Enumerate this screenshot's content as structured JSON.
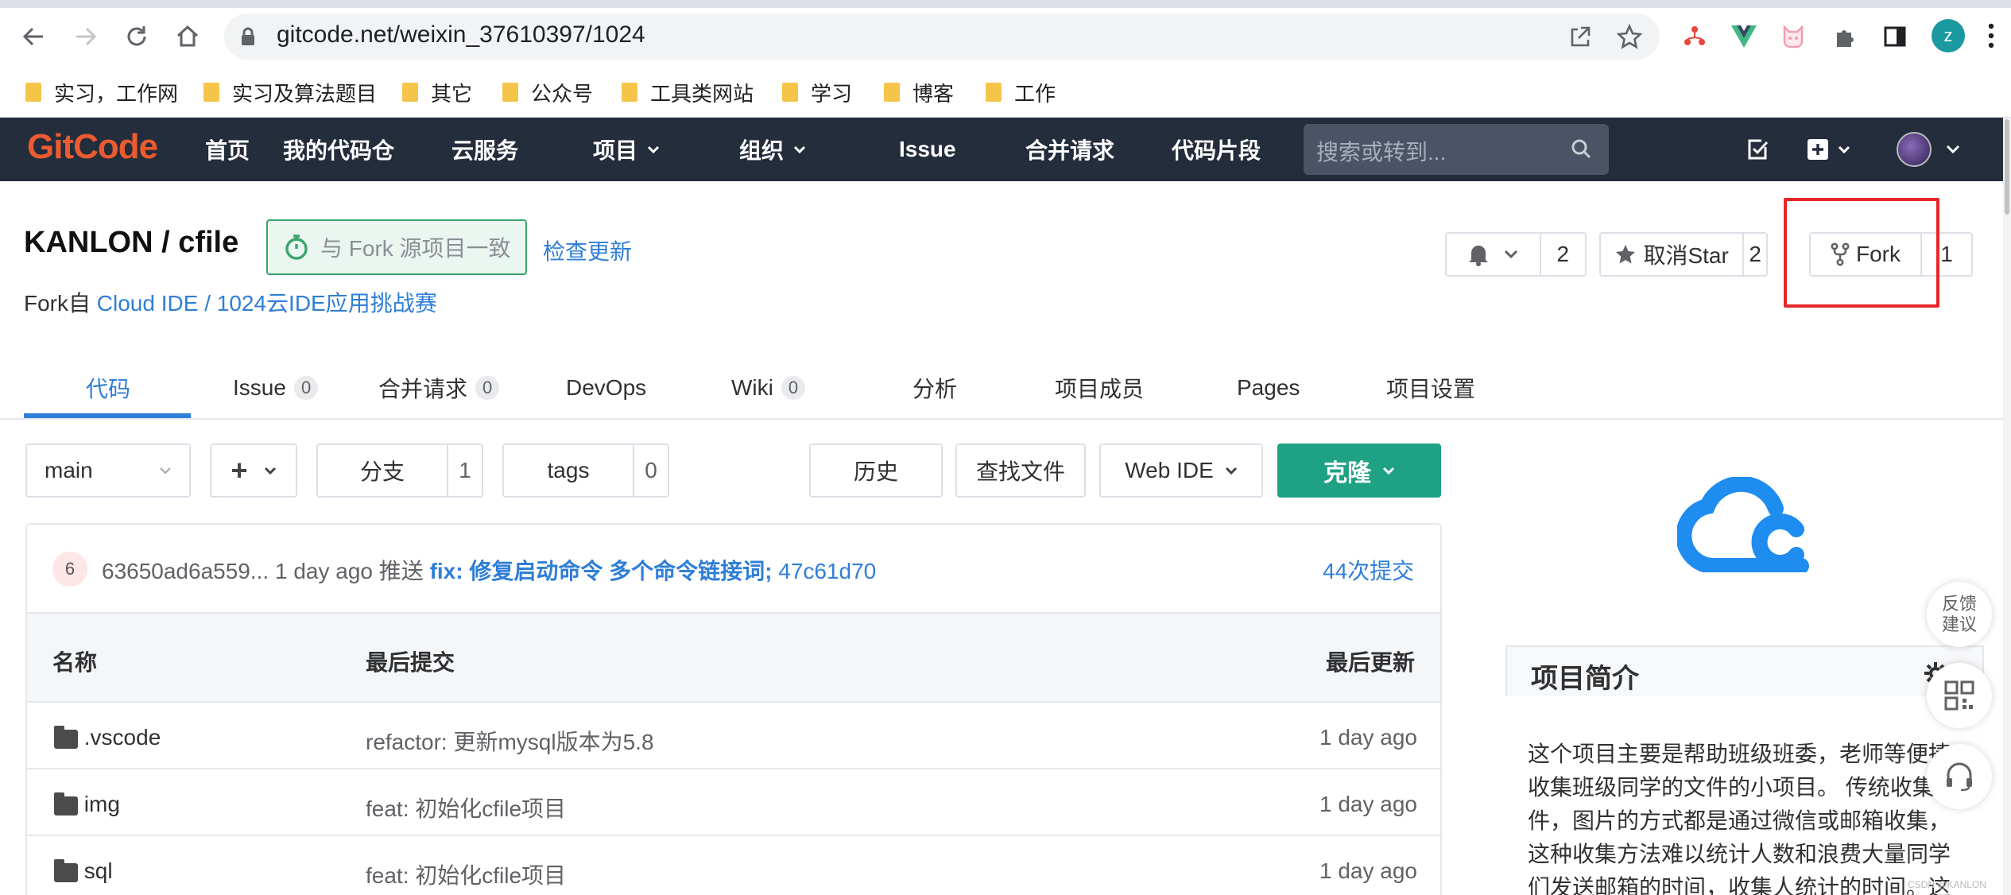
{
  "browser": {
    "url": "gitcode.net/weixin_37610397/1024",
    "profile_initial": "z",
    "bookmarks": [
      "实习，工作网",
      "实习及算法题目",
      "其它",
      "公众号",
      "工具类网站",
      "学习",
      "博客",
      "工作"
    ]
  },
  "gitcode_nav": {
    "logo": "GitCode",
    "items": [
      "首页",
      "我的代码仓",
      "云服务",
      "项目",
      "组织",
      "Issue",
      "合并请求",
      "代码片段"
    ],
    "search_placeholder": "搜索或转到..."
  },
  "project": {
    "title": "KANLON / cfile",
    "fork_sync_badge": "与 Fork 源项目一致",
    "check_update": "检查更新",
    "fork_from_prefix": "Fork自",
    "fork_from_link": "Cloud IDE / 1024云IDE应用挑战赛",
    "notify_count": "2",
    "star_label": "取消Star",
    "star_count": "2",
    "fork_label": "Fork",
    "fork_count": "1"
  },
  "tabs": [
    {
      "label": "代码",
      "count": null,
      "active": true
    },
    {
      "label": "Issue",
      "count": "0"
    },
    {
      "label": "合并请求",
      "count": "0"
    },
    {
      "label": "DevOps",
      "count": null
    },
    {
      "label": "Wiki",
      "count": "0"
    },
    {
      "label": "分析",
      "count": null
    },
    {
      "label": "项目成员",
      "count": null
    },
    {
      "label": "Pages",
      "count": null
    },
    {
      "label": "项目设置",
      "count": null
    }
  ],
  "toolbar": {
    "branch": "main",
    "add": "+",
    "branches_label": "分支",
    "branches_count": "1",
    "tags_label": "tags",
    "tags_count": "0",
    "history": "历史",
    "find_file": "查找文件",
    "web_ide": "Web IDE",
    "clone": "克隆"
  },
  "last_commit": {
    "avatar_text": "6",
    "author": "63650ad6a559...",
    "time": "1 day ago",
    "action": "推送",
    "message": "fix: 修复启动命令 多个命令链接词;",
    "sha": "47c61d70",
    "total": "44次提交"
  },
  "file_table": {
    "headers": {
      "name": "名称",
      "last_commit": "最后提交",
      "last_update": "最后更新"
    },
    "rows": [
      {
        "name": ".vscode",
        "commit": "refactor: 更新mysql版本为5.8",
        "updated": "1 day ago"
      },
      {
        "name": "img",
        "commit": "feat: 初始化cfile项目",
        "updated": "1 day ago"
      },
      {
        "name": "sql",
        "commit": "feat: 初始化cfile项目",
        "updated": "1 day ago"
      }
    ]
  },
  "sidebar": {
    "intro_title": "项目简介",
    "intro_text": "这个项目主要是帮助班级班委，老师等便捷收集班级同学的文件的小项目。 传统收集文件，图片的方式都是通过微信或邮箱收集，这种收集方法难以统计人数和浪费大量同学们发送邮箱的时间，收集人统计的时间。这",
    "feedback": "反馈建议",
    "watermark": "CSDN @KANLON"
  },
  "colors": {
    "nav_bg": "#242d3c",
    "accent": "#2f7ed8",
    "clone": "#1fa184",
    "highlight": "#e8262a",
    "logo": "#ec5a30"
  }
}
